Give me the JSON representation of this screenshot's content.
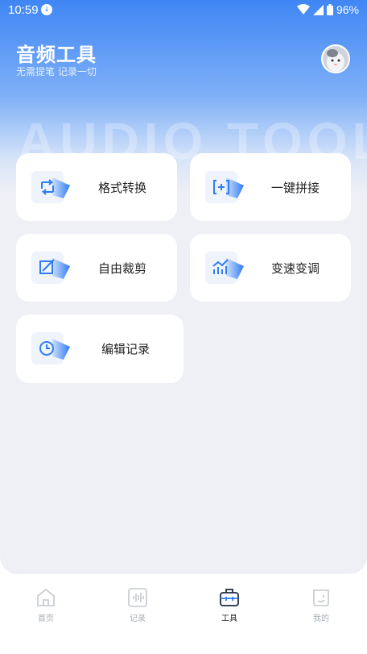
{
  "status_bar": {
    "time": "10:59",
    "battery": "96%"
  },
  "header": {
    "title": "音频工具",
    "subtitle": "无需提笔 记录一切",
    "watermark": "AUDIO TOOLS"
  },
  "tools": [
    {
      "label": "格式转换",
      "icon": "format-convert-icon"
    },
    {
      "label": "一键拼接",
      "icon": "merge-icon"
    },
    {
      "label": "自由裁剪",
      "icon": "crop-icon"
    },
    {
      "label": "变速变调",
      "icon": "speed-pitch-icon"
    },
    {
      "label": "编辑记录",
      "icon": "history-clock-icon"
    }
  ],
  "tab_bar": {
    "items": [
      {
        "label": "首页",
        "icon": "home-icon"
      },
      {
        "label": "记录",
        "icon": "waveform-icon"
      },
      {
        "label": "工具",
        "icon": "toolbox-icon",
        "active": true
      },
      {
        "label": "我的",
        "icon": "profile-icon"
      }
    ]
  },
  "colors": {
    "accent": "#2f7cf6",
    "header_gradient_top": "#3f86f5",
    "background": "#eef0f6"
  }
}
